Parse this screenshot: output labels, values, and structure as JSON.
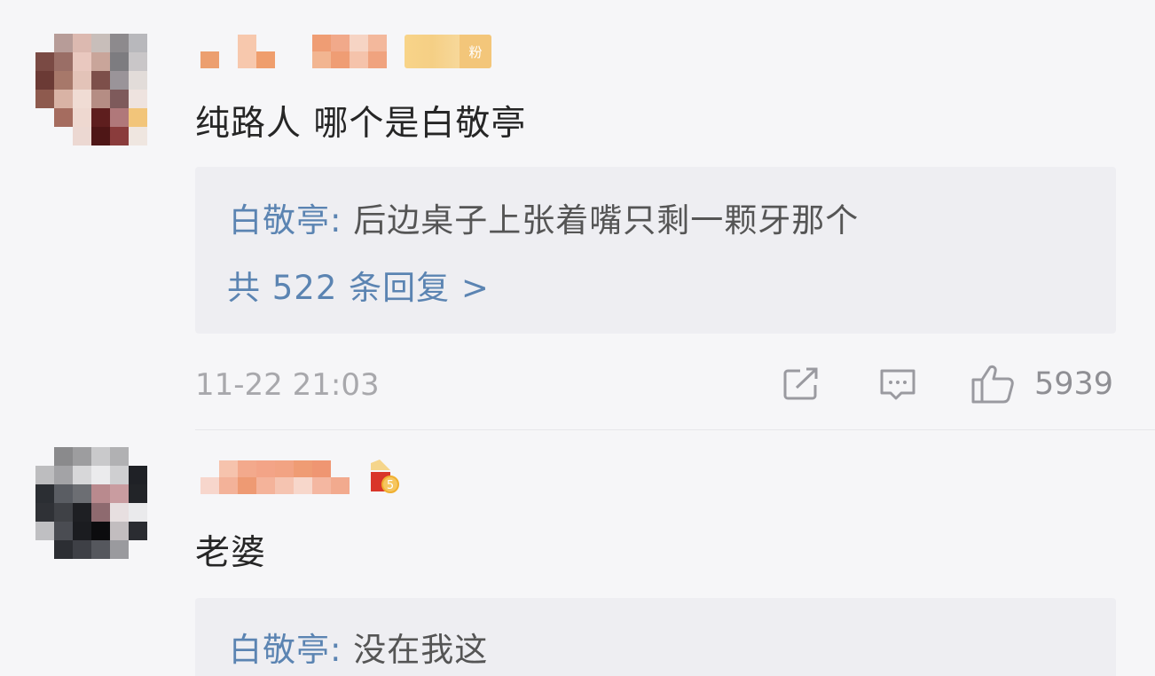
{
  "comments": [
    {
      "fan_badge": "粉",
      "text": "纯路人 哪个是白敬亭",
      "reply": {
        "author": "白敬亭:",
        "text": "后边桌子上张着嘴只剩一颗牙那个"
      },
      "more_replies": "共 522 条回复 >",
      "timestamp": "11-22 21:03",
      "like_count": "5939"
    },
    {
      "text": "老婆",
      "reply": {
        "author": "白敬亭:",
        "text": "没在我这"
      }
    }
  ],
  "icons": {
    "share": "share-icon",
    "reply": "comment-icon",
    "like": "thumbs-up-icon"
  },
  "colors": {
    "background": "#f6f6f8",
    "reply_box": "#eeeef2",
    "link": "#5b84b2",
    "text": "#262626",
    "meta": "#a8a8ac",
    "fan_badge": "#f3c67a"
  }
}
